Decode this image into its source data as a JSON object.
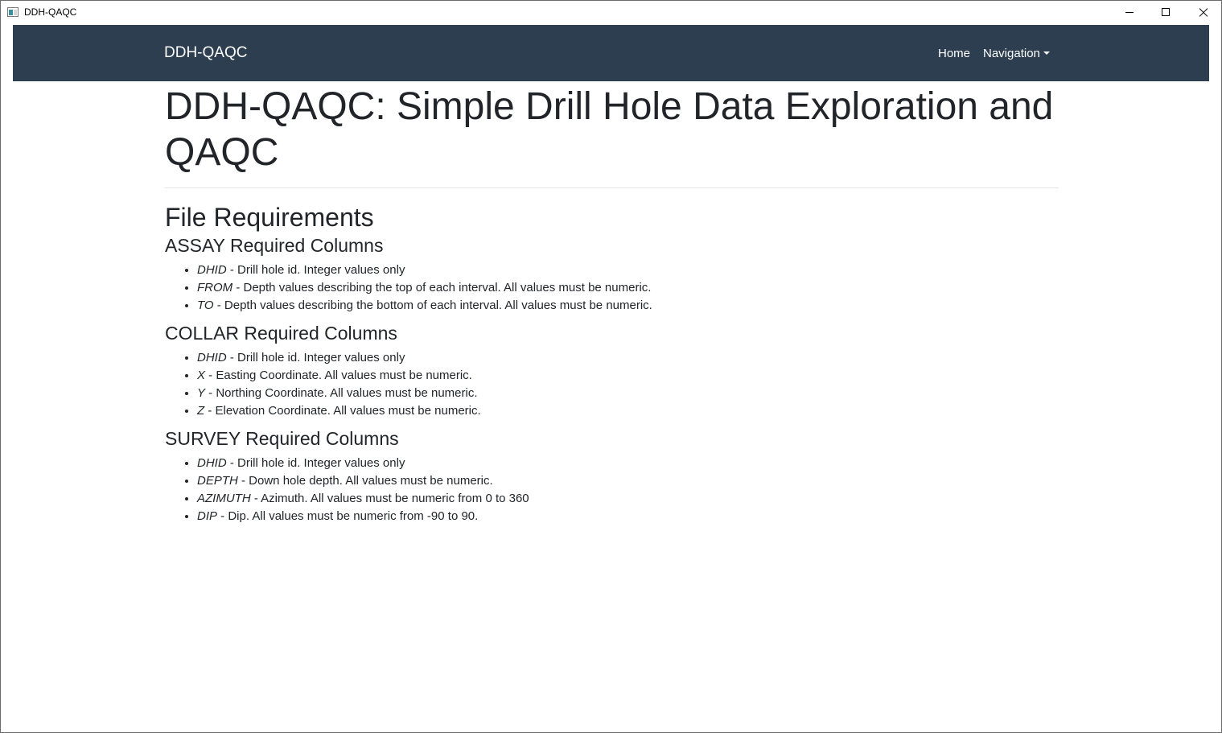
{
  "window": {
    "title": "DDH-QAQC",
    "controls": [
      "minimize",
      "maximize",
      "close"
    ]
  },
  "navbar": {
    "brand": "DDH-QAQC",
    "home_label": "Home",
    "navigation_label": "Navigation",
    "background_color": "#2c3e50"
  },
  "page": {
    "title": "DDH-QAQC: Simple Drill Hole Data Exploration and QAQC",
    "section_title": "File Requirements",
    "assay": {
      "heading": "ASSAY Required Columns",
      "items": [
        {
          "name": "DHID",
          "desc": " - Drill hole id. Integer values only"
        },
        {
          "name": "FROM",
          "desc": " - Depth values describing the top of each interval. All values must be numeric."
        },
        {
          "name": "TO",
          "desc": " - Depth values describing the bottom of each interval. All values must be numeric."
        }
      ]
    },
    "collar": {
      "heading": "COLLAR Required Columns",
      "items": [
        {
          "name": "DHID",
          "desc": " - Drill hole id. Integer values only"
        },
        {
          "name": "X",
          "desc": " - Easting Coordinate. All values must be numeric."
        },
        {
          "name": "Y",
          "desc": " - Northing Coordinate. All values must be numeric."
        },
        {
          "name": "Z",
          "desc": " - Elevation Coordinate. All values must be numeric."
        }
      ]
    },
    "survey": {
      "heading": "SURVEY Required Columns",
      "items": [
        {
          "name": "DHID",
          "desc": " - Drill hole id. Integer values only"
        },
        {
          "name": "DEPTH",
          "desc": " - Down hole depth. All values must be numeric."
        },
        {
          "name": "AZIMUTH",
          "desc": " - Azimuth. All values must be numeric from 0 to 360"
        },
        {
          "name": "DIP",
          "desc": " - Dip. All values must be numeric from -90 to 90."
        }
      ]
    }
  }
}
